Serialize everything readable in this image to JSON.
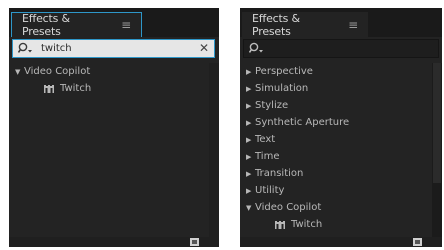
{
  "left_panel": {
    "tab_label": "Effects & Presets",
    "menu_glyph": "≡",
    "search": {
      "value": "twitch",
      "placeholder": ""
    },
    "tree": [
      {
        "label": "Video Copilot",
        "expanded": true,
        "level": 0
      },
      {
        "label": "Twitch",
        "level": 1,
        "icon": "effect-icon"
      }
    ]
  },
  "right_panel": {
    "tab_label": "Effects & Presets",
    "menu_glyph": "≡",
    "search": {
      "value": "",
      "placeholder": ""
    },
    "tree": [
      {
        "label": "Perspective",
        "expanded": false,
        "level": 0
      },
      {
        "label": "Simulation",
        "expanded": false,
        "level": 0
      },
      {
        "label": "Stylize",
        "expanded": false,
        "level": 0
      },
      {
        "label": "Synthetic Aperture",
        "expanded": false,
        "level": 0
      },
      {
        "label": "Text",
        "expanded": false,
        "level": 0
      },
      {
        "label": "Time",
        "expanded": false,
        "level": 0
      },
      {
        "label": "Transition",
        "expanded": false,
        "level": 0
      },
      {
        "label": "Utility",
        "expanded": false,
        "level": 0
      },
      {
        "label": "Video Copilot",
        "expanded": true,
        "level": 0
      },
      {
        "label": "Twitch",
        "level": 1,
        "icon": "effect-icon"
      }
    ]
  },
  "colors": {
    "panel_bg": "#232323",
    "focus_border": "#2e97c9",
    "text": "#b8b8b8"
  }
}
